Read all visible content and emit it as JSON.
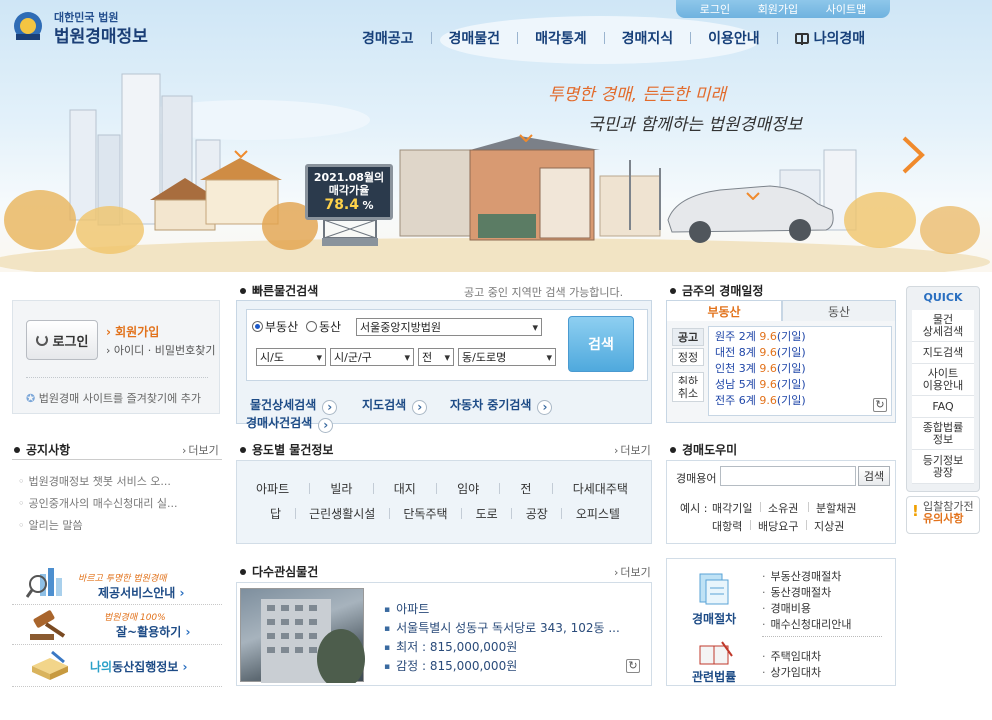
{
  "header": {
    "logo_sub": "대한민국 법원",
    "logo_main": "법원경매정보",
    "util": [
      "로그인",
      "회원가입",
      "사이트맵"
    ],
    "gnb": [
      "경매공고",
      "경매물건",
      "매각통계",
      "경매지식",
      "이용안내"
    ],
    "my_auction": "나의경매",
    "slogan1": "투명한 경매, 든든한 미래",
    "slogan2": "국민과 함께하는 법원경매정보",
    "billboard_title": "2021.08월의",
    "billboard_sub": "매각가율",
    "billboard_value": "78.4",
    "billboard_unit": "%"
  },
  "login": {
    "button": "로그인",
    "join": "회원가입",
    "find": "아이디 · 비밀번호찾기",
    "favorite": "법원경매 사이트를 즐겨찾기에 추가"
  },
  "quick_search": {
    "title": "빠른물건검색",
    "note": "공고 중인 지역만 검색 가능합니다.",
    "radio_realestate": "부동산",
    "radio_movable": "동산",
    "court": "서울중앙지방법원",
    "sido": "시/도",
    "sigungu": "시/군/구",
    "all": "전",
    "dong": "동/도로명",
    "search_button": "검색",
    "links": [
      "물건상세검색",
      "지도검색",
      "자동차 중기검색",
      "경매사건검색"
    ]
  },
  "schedule": {
    "title": "금주의 경매일정",
    "tab_realestate": "부동산",
    "tab_movable": "동산",
    "side": [
      "공고",
      "정정",
      "취하",
      "취소"
    ],
    "rows": [
      {
        "court": "원주 2계",
        "date": "9.6",
        "type": "(기일)"
      },
      {
        "court": "대전 8계",
        "date": "9.6",
        "type": "(기일)"
      },
      {
        "court": "인천 3계",
        "date": "9.6",
        "type": "(기일)"
      },
      {
        "court": "성남 5계",
        "date": "9.6",
        "type": "(기일)"
      },
      {
        "court": "전주 6계",
        "date": "9.6",
        "type": "(기일)"
      }
    ]
  },
  "quick_menu": {
    "title": "QUICK",
    "items": [
      "물건\n상세검색",
      "지도검색",
      "사이트\n이용안내",
      "FAQ",
      "종합법률\n정보",
      "등기정보\n광장"
    ],
    "warn_line1": "입찰참가전",
    "warn_line2": "유의사항"
  },
  "notices": {
    "title": "공지사항",
    "more": "더보기",
    "items": [
      "법원경매정보 챗봇 서비스 오...",
      "공인중개사의 매수신청대리 실...",
      "알리는 말씀"
    ]
  },
  "usage": {
    "title": "용도별 물건정보",
    "more": "더보기",
    "row1": [
      "아파트",
      "빌라",
      "대지",
      "임야",
      "전",
      "다세대주택"
    ],
    "row2": [
      "답",
      "근린생활시설",
      "단독주택",
      "도로",
      "공장",
      "오피스텔"
    ]
  },
  "dictionary": {
    "title": "경매도우미",
    "label": "경매용어",
    "button": "검색",
    "example_label": "예시 :",
    "row1": [
      "매각기일",
      "소유권",
      "분할채권"
    ],
    "row2": [
      "대항력",
      "배당요구",
      "지상권"
    ]
  },
  "promos": [
    {
      "small": "바르고 투명한 법원경매",
      "main": "제공서비스안내"
    },
    {
      "small": "법원경매 100%",
      "main": "잘~활용하기"
    },
    {
      "small": "",
      "main_prefix": "나의",
      "main": "동산집행정보"
    }
  ],
  "popular": {
    "title": "다수관심물건",
    "more": "더보기",
    "type": "아파트",
    "address": "서울특별시 성동구 독서당로 343, 102동 ...",
    "min_price": "최저 : 815,000,000원",
    "appraisal": "감정 : 815,000,000원"
  },
  "procedures": {
    "head1": "경매절차",
    "items1": [
      "부동산경매절차",
      "동산경매절차",
      "경매비용",
      "매수신청대리안내"
    ],
    "head2": "관련법률",
    "items2": [
      "주택임대차",
      "상가임대차"
    ]
  },
  "colors": {
    "accent_orange": "#e2721b",
    "navy": "#1d4b86",
    "date_orange": "#e2721b"
  }
}
